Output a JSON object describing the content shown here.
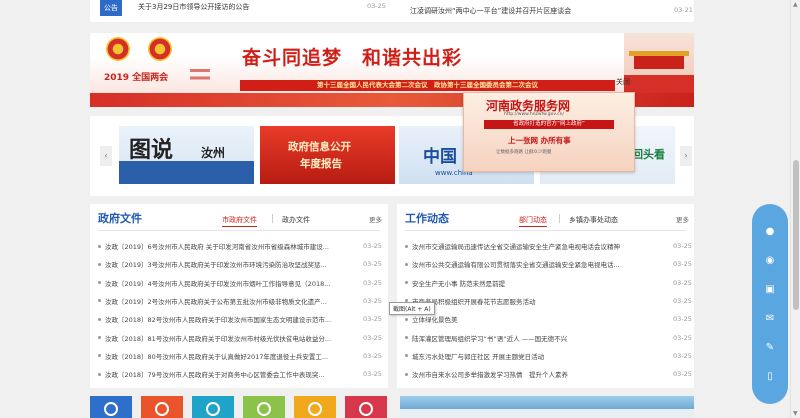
{
  "top": {
    "left_icon": "公告",
    "left_text": "关于3月29日市领导公开接访的公告",
    "left_date": "03-25",
    "right_text": "江凌调研汝州“两中心一平台”建设并召开片区座谈会",
    "right_date": "03-21"
  },
  "banner": {
    "lianghui": "2019 全国两会",
    "slogan": "奋斗同追梦　和谐共出彩",
    "sub_slogan": "第十三届全国人民代表大会第二次会议　政协第十三届全国委员会第二次会议",
    "close": "关闭"
  },
  "carousel": {
    "prev": "‹",
    "next": "›",
    "slide1_big": "图说",
    "slide1_city": "汝州",
    "slide2_line1": "政府信息公开",
    "slide2_line2": "年度报告",
    "slide3_text": "中国",
    "slide3_url": "www.china",
    "slide4_text": "回头看"
  },
  "popup": {
    "title": "河南政务服务网",
    "url": "http://www.hnzwfw.gov.cn/",
    "band": "省政府打造的官方“网上政府”",
    "line2": "上一张网 办所有事",
    "line3": "让数据多跑路 让群众少跑腿"
  },
  "green_dot": "汝",
  "left_panel": {
    "title": "政府文件",
    "tab_active": "市政府文件",
    "tab_other": "政办文件",
    "more": "更多",
    "items": [
      {
        "text": "汝政〔2019〕6号汝州市人民政府 关于印发河南省汝州市省级森林城市建设...",
        "date": "03-25"
      },
      {
        "text": "汝政〔2019〕3号汝州市人民政府关于印发汝州市环境污染防治攻坚战奖惩...",
        "date": "03-25"
      },
      {
        "text": "汝政〔2019〕4号汝州市人民政府关于印发汝州市烟叶工作指导意见（2018...",
        "date": "03-25"
      },
      {
        "text": "汝政〔2019〕2号汝州市人民政府关于公布第五批汝州市级非物质文化遗产...",
        "date": "03-25"
      },
      {
        "text": "汝政〔2018〕82号汝州市人民政府关于印发汝州市国家生态文明建设示范市...",
        "date": "03-25"
      },
      {
        "text": "汝政〔2018〕81号汝州市人民政府关于印发汝州市村级光伏扶贫电站收益分...",
        "date": "03-25"
      },
      {
        "text": "汝政〔2018〕80号汝州市人民政府关于认真做好2017年度退役士兵安置工...",
        "date": "03-25"
      },
      {
        "text": "汝政〔2018〕79号汝州市人民政府关于对商务中心区管委会工作中表现突...",
        "date": "03-25"
      }
    ]
  },
  "right_panel": {
    "title": "工作动态",
    "tab_active": "部门动态",
    "tab_other": "乡镇办事处动态",
    "more": "更多",
    "items": [
      {
        "text": "汝州市交通运输局迅速传达全省交通运输安全生产紧急电视电话会议精神",
        "date": "03-25"
      },
      {
        "text": "汝州市公共交通运输有限公司贯彻落实全省交通运输安全紧急电视电话...",
        "date": "03-25"
      },
      {
        "text": "安全生产无小事 防范未然是前提",
        "date": "03-25"
      },
      {
        "text": "市商务局积极组织开展春花节志愿服务活动",
        "date": "03-25"
      },
      {
        "text": "立体绿化景色美",
        "date": "03-25"
      },
      {
        "text": "陆浑灌区管理局组织学习“书”语“近人 ——国无德不兴",
        "date": "03-25"
      },
      {
        "text": "城东污水处理厂与郭庄社区 开展主题党日活动",
        "date": "03-25"
      },
      {
        "text": "汝州市自来水公司多举措激发学习热情　提升个人素养",
        "date": "03-25"
      }
    ]
  },
  "tooltip": "截图(Alt + A)",
  "tiles": [
    {
      "color": "#2e6fcc"
    },
    {
      "color": "#e9542b"
    },
    {
      "color": "#1fa3c9"
    },
    {
      "color": "#8bc34a"
    },
    {
      "color": "#f2a81d"
    },
    {
      "color": "#d6374a"
    }
  ],
  "sidebar_icons": [
    "wechat-icon",
    "weibo-icon",
    "qzone-icon",
    "email-icon",
    "edit-icon",
    "mobile-icon"
  ]
}
